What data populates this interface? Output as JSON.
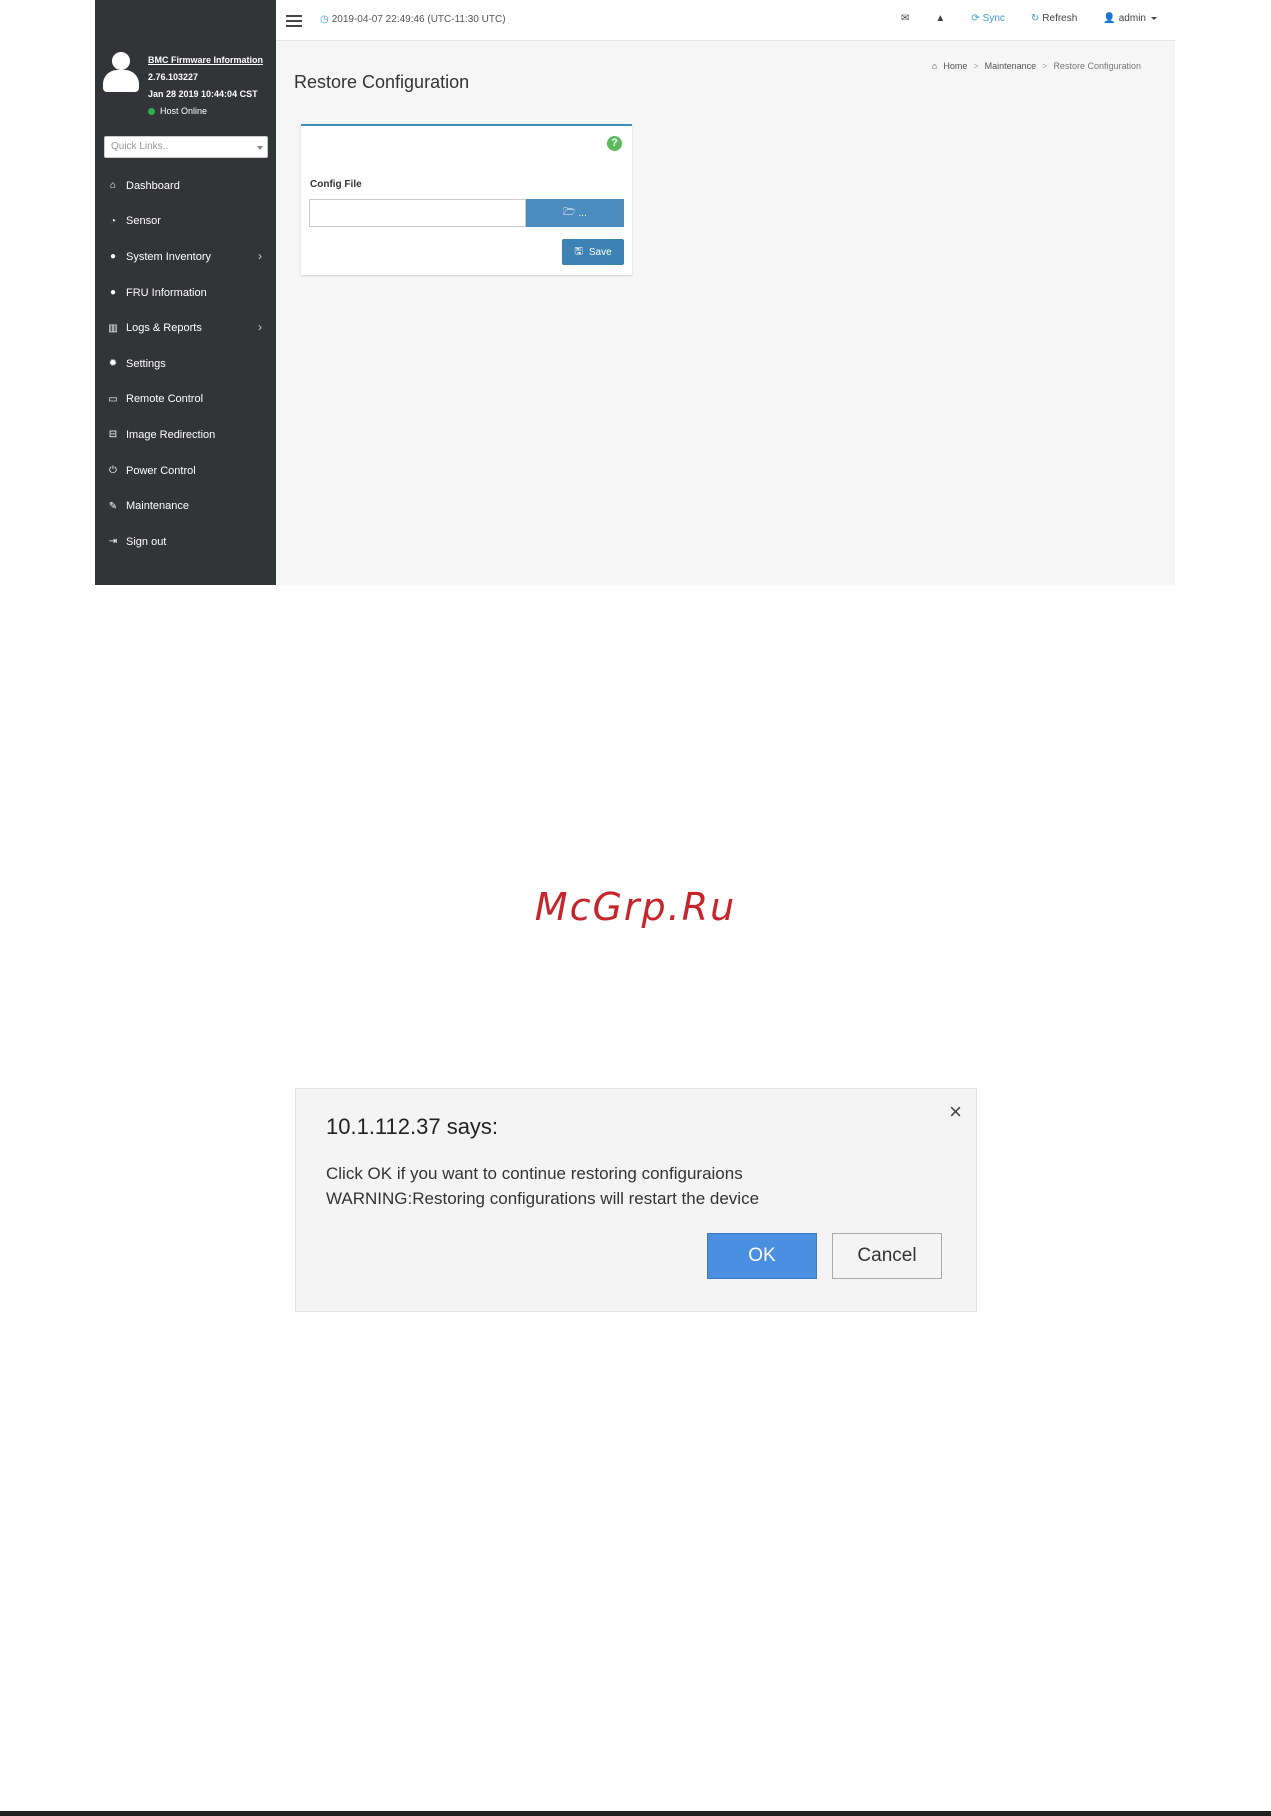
{
  "topbar": {
    "datetime": "2019-04-07 22:49:46 (UTC-11:30 UTC)",
    "sync_label": "Sync",
    "refresh_label": "Refresh",
    "user_label": "admin"
  },
  "sidebar": {
    "firmware_title": "BMC Firmware Information",
    "firmware_version": "2.76.103227",
    "firmware_date": "Jan 28 2019 10:44:04 CST",
    "host_status": "Host Online",
    "quick_links_placeholder": "Quick Links..",
    "items": [
      {
        "label": "Dashboard",
        "icon": "home-icon"
      },
      {
        "label": "Sensor",
        "icon": "tachometer-icon"
      },
      {
        "label": "System Inventory",
        "icon": "info-icon",
        "has_submenu": true
      },
      {
        "label": "FRU Information",
        "icon": "info-icon"
      },
      {
        "label": "Logs & Reports",
        "icon": "bar-chart-icon",
        "has_submenu": true
      },
      {
        "label": "Settings",
        "icon": "gear-icon"
      },
      {
        "label": "Remote Control",
        "icon": "monitor-icon"
      },
      {
        "label": "Image Redirection",
        "icon": "drive-icon"
      },
      {
        "label": "Power Control",
        "icon": "power-icon"
      },
      {
        "label": "Maintenance",
        "icon": "wrench-icon"
      },
      {
        "label": "Sign out",
        "icon": "sign-out-icon"
      }
    ]
  },
  "main": {
    "page_title": "Restore Configuration",
    "breadcrumb": [
      "Home",
      "Maintenance",
      "Restore Configuration"
    ],
    "config_file_label": "Config File",
    "browse_label": "...",
    "save_label": "Save"
  },
  "watermark": "McGrp.Ru",
  "dialog": {
    "title": "10.1.112.37 says:",
    "message_line1": "Click OK if you want to continue restoring configuraions",
    "message_line2": "WARNING:Restoring configurations will restart the device",
    "ok_label": "OK",
    "cancel_label": "Cancel",
    "close_glyph": "×"
  },
  "colors": {
    "sidebar_bg": "#333438",
    "accent_blue": "#3c8dbc",
    "ok_button": "#4a8fe0",
    "host_online": "#2bb24c",
    "help_icon": "#5cb85c",
    "watermark": "#c6262b"
  }
}
